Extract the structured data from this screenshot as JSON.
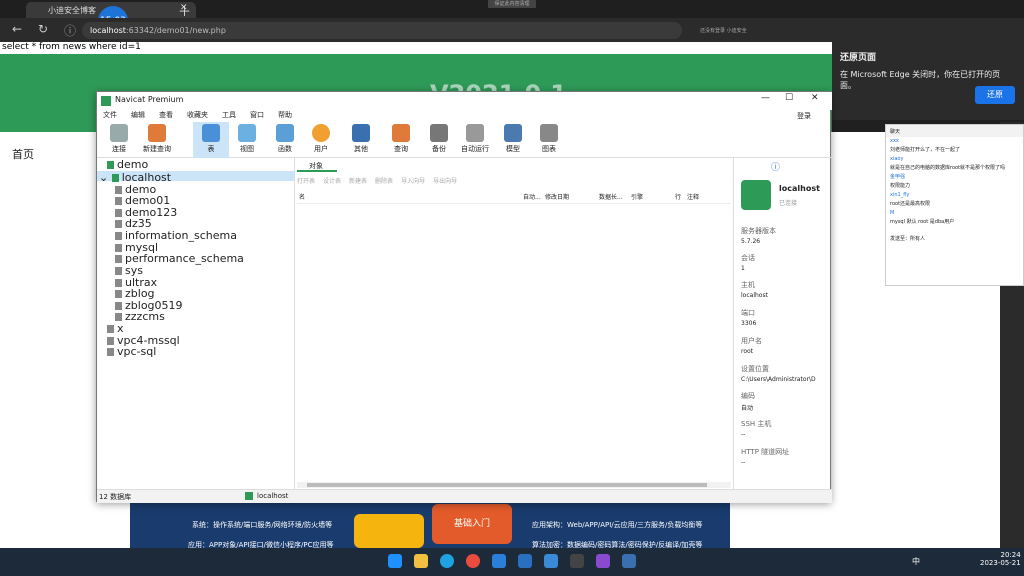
{
  "browser": {
    "tab_title": "小迪安全博客",
    "clock": "15:03",
    "recording": "保证此内容清理",
    "url_host": "localhost",
    "url_path": ":63342/demo01/new.php",
    "profile_text": "还没有登录 小迪安全"
  },
  "page": {
    "sql": "select * from news where id=1",
    "green_title": "V2021.0.1",
    "home_link": "首页",
    "banner_lines": [
      "系统：操作系统/端口服务/网络环境/防火墙等",
      "应用：APP对象/API接口/微信小程序/PC应用等"
    ],
    "banner_right": [
      "应用架构：Web/APP/API/云应用/三方服务/负载均衡等",
      "算法加密：数据编码/密码算法/密码保护/反编译/加壳等"
    ],
    "banner_center": "基础入门"
  },
  "edge_popup": {
    "title": "还原页面",
    "text": "在 Microsoft Edge 关闭时，你在已打开的页面。",
    "button": "还原"
  },
  "chat": {
    "title": "聊天",
    "messages": [
      {
        "name": "xxx",
        "text": "刘老师能打开么了，不在一起了"
      },
      {
        "name": "xiaoy",
        "text": "就是在自己的电脑的数据库root就不是那个权限了吗"
      },
      {
        "name": "金甲强",
        "text": "权限能力"
      },
      {
        "name": "xin1_fly",
        "text": "root还是最高权限"
      },
      {
        "name": "M",
        "text": "mysql 默认 root 是dba用户"
      }
    ],
    "send_to": "发送至：所有人"
  },
  "navicat": {
    "title": "Navicat Premium",
    "menus": [
      "文件",
      "编辑",
      "查看",
      "收藏夹",
      "工具",
      "窗口",
      "帮助"
    ],
    "login": "登录",
    "toolbar": [
      "连接",
      "新建查询",
      "表",
      "视图",
      "函数",
      "用户",
      "其他",
      "查询",
      "备份",
      "自动运行",
      "模型",
      "图表"
    ],
    "tree": {
      "conn_demo": "demo",
      "conn_localhost": "localhost",
      "dbs": [
        "demo",
        "demo01",
        "demo123",
        "dz35",
        "information_schema",
        "mysql",
        "performance_schema",
        "sys",
        "ultrax",
        "zblog",
        "zblog0519",
        "zzzcms"
      ],
      "others": [
        "x",
        "vpc4-mssql",
        "vpc-sql"
      ]
    },
    "obj_tab": "对象",
    "obj_toolbar": [
      "打开表",
      "设计表",
      "新建表",
      "删除表",
      "导入向导",
      "导出向导"
    ],
    "columns": [
      "名",
      "自动...",
      "修改日期",
      "数据长...",
      "引擎",
      "行",
      "注释"
    ],
    "info": {
      "name": "localhost",
      "sub": "已连接",
      "labels": [
        "服务器版本",
        "会话",
        "主机",
        "端口",
        "用户名",
        "设置位置",
        "编码",
        "SSH 主机",
        "HTTP 隧道网址"
      ],
      "values": [
        "5.7.26",
        "1",
        "localhost",
        "3306",
        "root",
        "C:\\Users\\Administrator\\D",
        "自动",
        "--",
        "--"
      ]
    },
    "status_left": "12 数据库",
    "status_conn": "localhost"
  },
  "taskbar": {
    "time": "20:24",
    "date": "2023-05-21",
    "ime": "中"
  }
}
